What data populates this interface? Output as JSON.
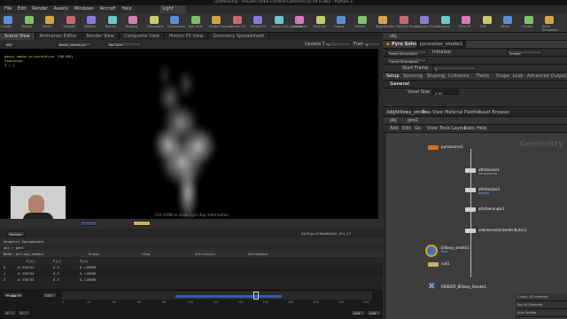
{
  "window_title": "untitled.hip - Houdini Indie Limited-Commercial 19.0.383 - Python 3",
  "menus": [
    "File",
    "Edit",
    "Render",
    "Assets",
    "Windows",
    "Aircraft",
    "Help"
  ],
  "build_dropdown": "Light",
  "shelf_labels": [
    "Create",
    "Modify",
    "Model",
    "Polygon",
    "Deform",
    "Texture",
    "Rigging",
    "Characters",
    "Constraints",
    "Hair Utils",
    "Guide Process",
    "Terrain FX",
    "Simple FX",
    "Lights and Cameras",
    "Collisions",
    "Particles",
    "Grains",
    "Vellum",
    "Rigid Bodies",
    "Particle Fluids",
    "Viscous Fluids",
    "Oceans",
    "Pyro FX",
    "FEM",
    "Wires",
    "Crowds",
    "Drive Simulation"
  ],
  "pane_tabs": [
    "Scene View",
    "Animation Editor",
    "Render View",
    "Composite View",
    "Motion FX View",
    "Geometry Spreadsheet"
  ],
  "viewport": {
    "path_button": "obj",
    "node_button": "basic_smoke_pr",
    "camera": "No Cam",
    "update_label": "Update Time",
    "update_value": "1",
    "frame_label": "Frame",
    "frame_value": "1",
    "info_lines": [
      "basic_smoke_pr/pyroSolver (SOLVED)",
      "Simulated",
      "1 / 1"
    ],
    "hint": "Ctrl+LMB to show pyro dop information",
    "status_left": "Render",
    "status_path": "/DOP/pyr/FINAMAN00_SF4_57"
  },
  "spreadsheet": {
    "title": "Geometry Spreadsheet",
    "node": "Node: billowy_smoke1",
    "group_label": "Group:",
    "view_label": "View",
    "intrinsics_label": "Intrinsics",
    "attributes_label": "Attributes",
    "columns": [
      "",
      "P[x]",
      "P[y]",
      "P[z]"
    ],
    "rows": [
      [
        "0",
        "-0.338744",
        "0.5",
        "0.110898"
      ],
      [
        "1",
        "-0.338744",
        "0.5",
        "0.110898"
      ],
      [
        "2",
        "-0.338744",
        "0.5",
        "0.110898"
      ]
    ]
  },
  "timeline": {
    "current_frame": "240",
    "start": "1",
    "end": "240",
    "end2": "240",
    "keys_label": "0 keys, 0/0 channels",
    "key_all": "Key All Channels",
    "auto_update": "Auto Update",
    "ticks": [
      "1",
      "20",
      "40",
      "60",
      "80",
      "100",
      "120",
      "140",
      "160",
      "180",
      "200",
      "220",
      "240"
    ]
  },
  "params": {
    "path": "obj",
    "node_type": "Pyro Solver",
    "node_name": "pyrosolver_smoke1",
    "reset_label": "Reset Simulation",
    "initialize_label": "Initialize",
    "initialize_value": "Smoke",
    "cache_label": "Cache Simulation",
    "start_frame_label": "Start Frame",
    "start_frame_value": "1",
    "tabs": [
      "Setup",
      "Sourcing",
      "Shaping",
      "Collisions",
      "Fields",
      "Shape",
      "Look",
      "Advanced",
      "Output"
    ],
    "section": "General",
    "voxel_label": "Voxel Size",
    "voxel_value": "0.02"
  },
  "network": {
    "tabs": [
      "/obj/billowy_smoke",
      "Tree View",
      "Material Palette",
      "Asset Browser"
    ],
    "path": "obj",
    "path2": "geo1",
    "menu": [
      "Add",
      "Edit",
      "Go",
      "View",
      "Tools",
      "Layout",
      "Labs",
      "Help"
    ],
    "context_label": "Geometry",
    "nodes": [
      {
        "name": "pyrosource1"
      },
      {
        "name": "attribnoise1",
        "sub": "temperature"
      },
      {
        "name": "attribnoise2",
        "sub": "density"
      },
      {
        "name": "attribwrangle1"
      },
      {
        "name": "volumerasterizeattributes1"
      },
      {
        "name": "billowy_smoke1",
        "sub": "Pyro"
      },
      {
        "name": "null1"
      },
      {
        "name": "RENDER_Billowy_Smoke1"
      }
    ]
  },
  "colors": {
    "accent": "#e08a1a",
    "node_orange": "#d8731e",
    "node_blue": "#3a70c0",
    "bg_network": "#3d3d3d"
  }
}
